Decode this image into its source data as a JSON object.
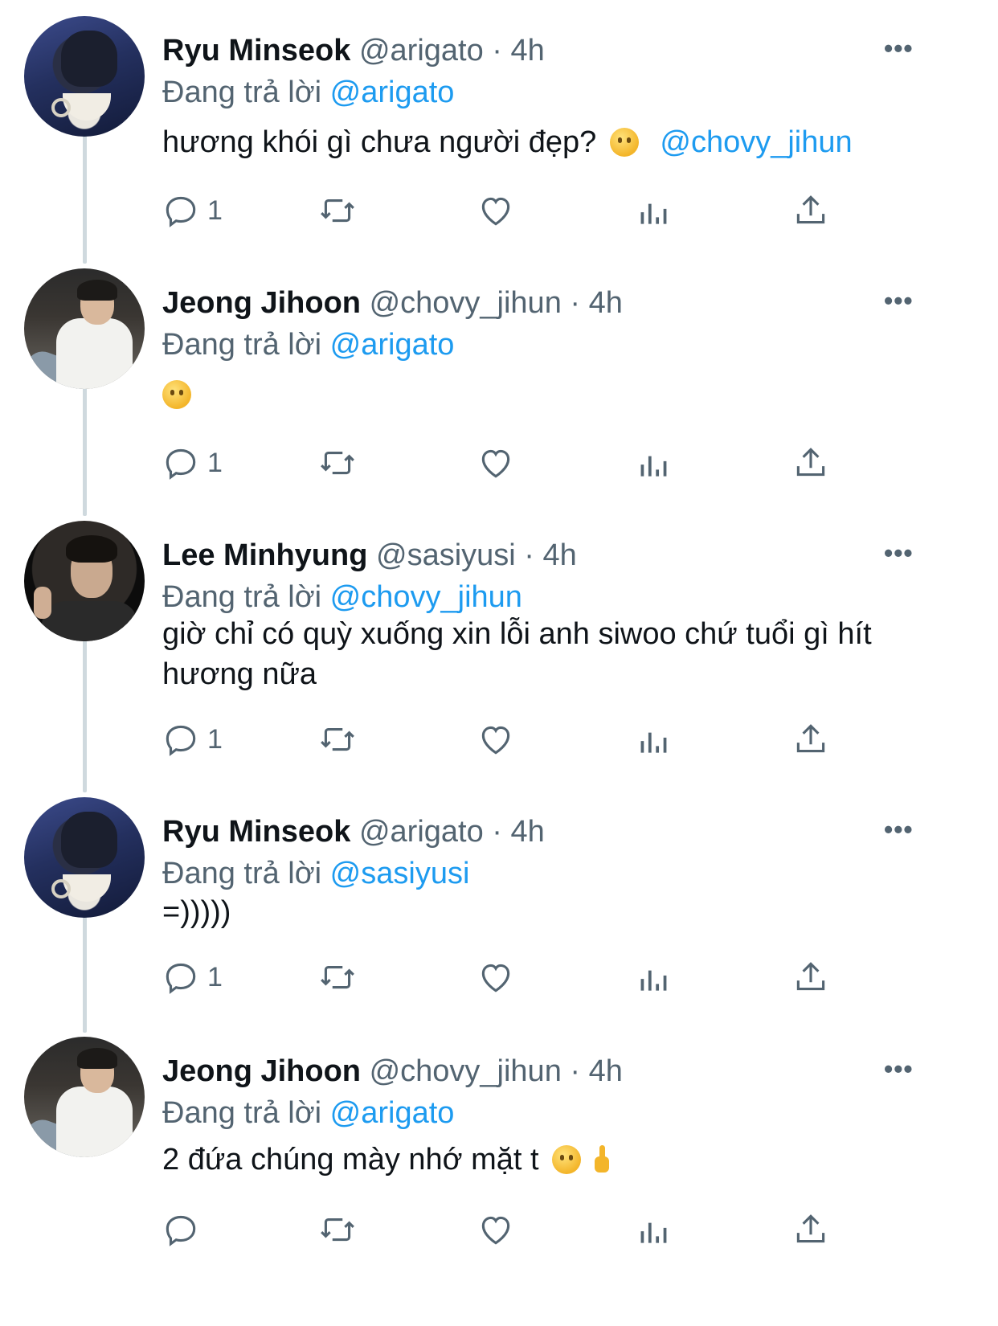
{
  "tweets": [
    {
      "name": "Ryu Minseok",
      "handle": "@arigato · 4h",
      "replying_prefix": "Đang trả lời",
      "replying_to": "@arigato",
      "text": "hương khói gì chưa người đẹp?",
      "mention": "@chovy_jihun",
      "reply_count": "1",
      "avatar": "ryu"
    },
    {
      "name": "Jeong Jihoon",
      "handle": "@chovy_jihun · 4h",
      "replying_prefix": "Đang trả lời",
      "replying_to": "@arigato",
      "text": "",
      "reply_count": "1",
      "avatar": "jeong"
    },
    {
      "name": "Lee Minhyung",
      "handle": "@sasiyusi · 4h",
      "replying_prefix": "Đang trả lời",
      "replying_to": "@chovy_jihun",
      "text": "giờ chỉ có quỳ xuống xin lỗi anh siwoo chứ tuổi gì hít hương nữa",
      "reply_count": "1",
      "avatar": "lee"
    },
    {
      "name": "Ryu Minseok",
      "handle": "@arigato · 4h",
      "replying_prefix": "Đang trả lời",
      "replying_to": "@sasiyusi",
      "text": "=)))))",
      "reply_count": "1",
      "avatar": "ryu"
    },
    {
      "name": "Jeong Jihoon",
      "handle": "@chovy_jihun · 4h",
      "replying_prefix": "Đang trả lời",
      "replying_to": "@arigato",
      "text": "2 đứa chúng mày nhớ mặt t",
      "reply_count": "",
      "avatar": "jeong"
    }
  ],
  "more_label": "•••",
  "icons": [
    "reply-icon",
    "retweet-icon",
    "like-icon",
    "views-icon",
    "share-icon"
  ],
  "colors": {
    "accent": "#1d9bf0",
    "secondary_text": "#536471",
    "thread_line": "#cfd9de"
  }
}
